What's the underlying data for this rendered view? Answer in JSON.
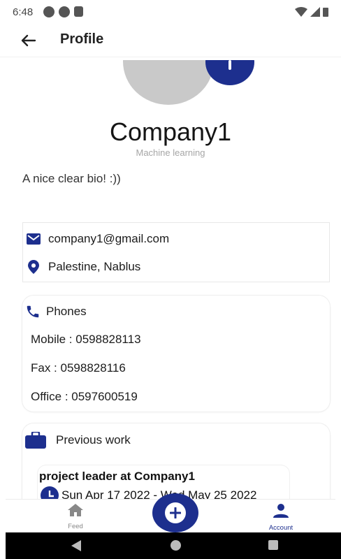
{
  "status_bar": {
    "time": "6:48"
  },
  "app_bar": {
    "title": "Profile"
  },
  "profile": {
    "name": "Company1",
    "field": "Machine learning",
    "bio": "A nice clear bio! :))"
  },
  "contact": {
    "email": "company1@gmail.com",
    "location": "Palestine, Nablus"
  },
  "phones": {
    "title": "Phones",
    "mobile": "Mobile : 0598828113",
    "fax": "Fax : 0598828116",
    "office": "Office : 0597600519"
  },
  "work": {
    "title": "Previous work",
    "items": [
      {
        "title": "project leader at Company1",
        "dates": "Sun Apr 17 2022 - Wed May 25 2022"
      }
    ]
  },
  "bottom_nav": {
    "feed_label": "Feed",
    "account_label": "Account"
  },
  "colors": {
    "accent": "#1d2f8e",
    "avatar_gray": "#c9c9c9"
  },
  "icons": [
    "back-arrow-icon",
    "email-icon",
    "location-pin-icon",
    "phone-icon",
    "briefcase-icon",
    "clock-icon",
    "home-icon",
    "person-icon",
    "plus-icon"
  ]
}
